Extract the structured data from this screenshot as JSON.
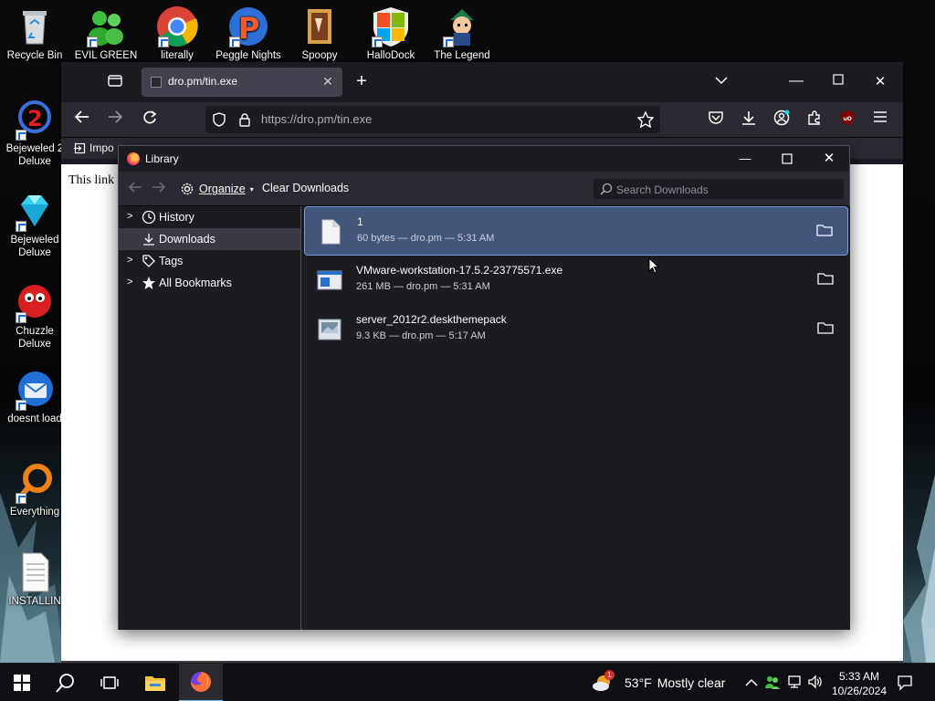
{
  "desktop": {
    "icons": [
      {
        "label": "Recycle Bin",
        "icon": "recycle-bin-icon"
      },
      {
        "label": "EVIL GREEN",
        "icon": "messenger-people-icon"
      },
      {
        "label": "literally",
        "icon": "chrome-icon"
      },
      {
        "label": "Peggle Nights",
        "icon": "peggle-icon"
      },
      {
        "label": "Spoopy",
        "icon": "spoopy-icon"
      },
      {
        "label": "HalloDock",
        "icon": "windows-shield-icon"
      },
      {
        "label": "The Legend",
        "icon": "legend-character-icon"
      },
      {
        "label": "Bejeweled 2 Deluxe",
        "icon": "bejeweled2-icon"
      },
      {
        "label": "Bejeweled Deluxe",
        "icon": "bejeweled-diamond-icon"
      },
      {
        "label": "Chuzzle Deluxe",
        "icon": "chuzzle-icon"
      },
      {
        "label": "doesnt load",
        "icon": "thunderbird-icon"
      },
      {
        "label": "Everything",
        "icon": "everything-search-icon"
      },
      {
        "label": "INSTALLIN",
        "icon": "text-document-icon"
      }
    ]
  },
  "firefox": {
    "tab_title": "dro.pm/tin.exe",
    "url": "https://dro.pm/tin.exe",
    "bookmark_partial": "Impo",
    "page_text": "This link"
  },
  "library": {
    "window_title": "Library",
    "organize_label": "Organize",
    "clear_label": "Clear Downloads",
    "search_placeholder": "Search Downloads",
    "sidebar": [
      {
        "label": "History",
        "icon": "clock-icon",
        "expandable": true,
        "selected": false
      },
      {
        "label": "Downloads",
        "icon": "download-icon",
        "expandable": false,
        "selected": true
      },
      {
        "label": "Tags",
        "icon": "tag-icon",
        "expandable": true,
        "selected": false
      },
      {
        "label": "All Bookmarks",
        "icon": "star-icon",
        "expandable": true,
        "selected": false
      }
    ],
    "downloads": [
      {
        "name": "1",
        "meta": "60 bytes — dro.pm — 5:31 AM",
        "icon": "blank-file-icon",
        "selected": true
      },
      {
        "name": "VMware-workstation-17.5.2-23775571.exe",
        "meta": "261 MB — dro.pm — 5:31 AM",
        "icon": "exe-file-icon",
        "selected": false
      },
      {
        "name": "server_2012r2.deskthemepack",
        "meta": "9.3 KB — dro.pm — 5:17 AM",
        "icon": "themepack-file-icon",
        "selected": false
      }
    ]
  },
  "taskbar": {
    "weather_temp": "53°F",
    "weather_text": "Mostly clear",
    "time": "5:33 AM",
    "date": "10/26/2024",
    "weather_badge": "1"
  },
  "colors": {
    "selection": "#42557a",
    "selection_border": "#7a9bd6",
    "window_bg": "#1c1b22",
    "toolbar_bg": "#2b2a33"
  }
}
